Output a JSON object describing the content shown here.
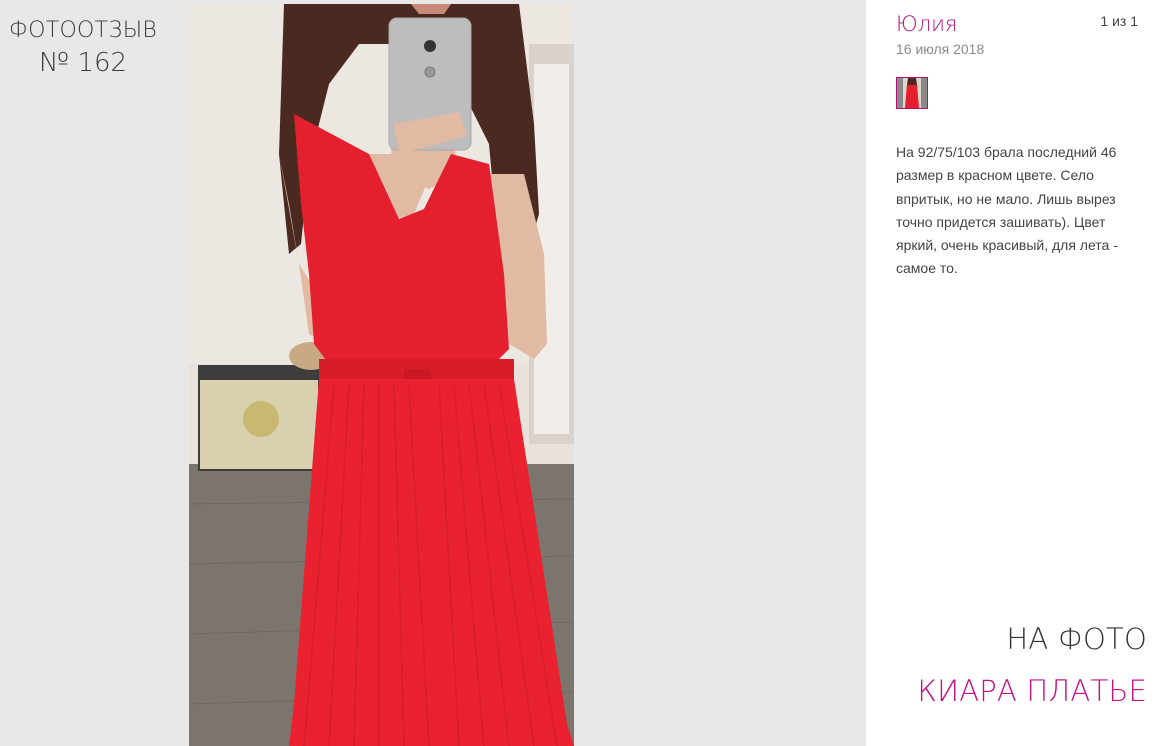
{
  "heading": {
    "line1": "ФОТООТЗЫВ",
    "line2": "№ 162"
  },
  "photo": {
    "icon": "review-photo",
    "colors": {
      "dress": "#e8202c",
      "wall": "#e6e0d8",
      "floor": "#7c756e",
      "phone": "#bdbdbd",
      "hair": "#4a2a20",
      "skin": "#e2b9a3"
    }
  },
  "review": {
    "author": "Юлия",
    "date": "16 июля 2018",
    "counter": "1 из 1",
    "text": "На 92/75/103 брала последний 46 размер в красном цвете. Село впритык, но не мало. Лишь вырез точно придется зашивать). Цвет яркий, очень красивый, для лета - самое то."
  },
  "product": {
    "label": "НА ФОТО",
    "name": "КИАРА ПЛАТЬЕ"
  },
  "colors": {
    "accent": "#c4127f",
    "panel_bg": "#e8e8e8",
    "text": "#444444"
  }
}
